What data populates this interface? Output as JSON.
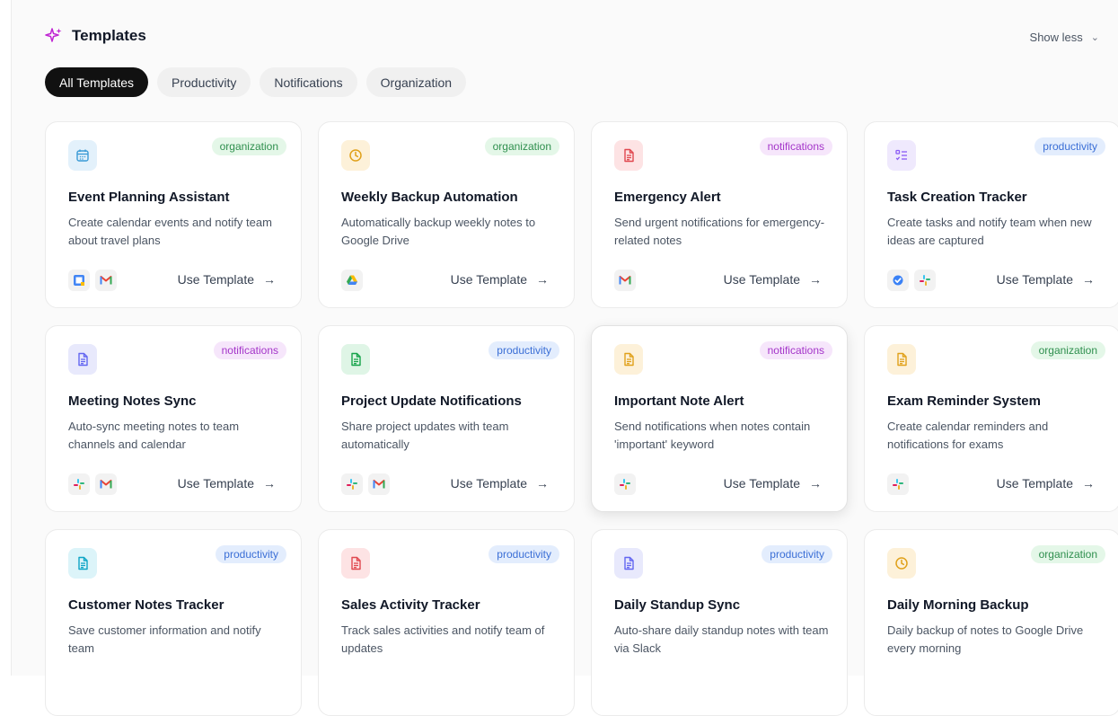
{
  "header": {
    "title": "Templates",
    "show_less": "Show less",
    "icon": "sparkle-icon"
  },
  "tabs": [
    {
      "label": "All Templates",
      "active": true
    },
    {
      "label": "Productivity",
      "active": false
    },
    {
      "label": "Notifications",
      "active": false
    },
    {
      "label": "Organization",
      "active": false
    }
  ],
  "use_template_label": "Use Template",
  "cards": [
    {
      "title": "Event Planning Assistant",
      "desc": "Create calendar events and notify team about travel plans",
      "badge": "organization",
      "icon": "calendar-icon",
      "icon_color": "#3b9bd6",
      "icon_bg": "#e3f1fb",
      "apps": [
        "google-calendar-icon",
        "gmail-icon"
      ]
    },
    {
      "title": "Weekly Backup Automation",
      "desc": "Automatically backup weekly notes to Google Drive",
      "badge": "organization",
      "icon": "clock-icon",
      "icon_color": "#e0a11b",
      "icon_bg": "#fdf1d9",
      "apps": [
        "google-drive-icon"
      ]
    },
    {
      "title": "Emergency Alert",
      "desc": "Send urgent notifications for emergency-related notes",
      "badge": "notifications",
      "icon": "document-icon",
      "icon_color": "#e0484f",
      "icon_bg": "#fde3e4",
      "apps": [
        "gmail-icon"
      ]
    },
    {
      "title": "Task Creation Tracker",
      "desc": "Create tasks and notify team when new ideas are captured",
      "badge": "productivity",
      "icon": "checklist-icon",
      "icon_color": "#8b5cf6",
      "icon_bg": "#efe9fd",
      "apps": [
        "task-check-icon",
        "slack-icon"
      ]
    },
    {
      "title": "Meeting Notes Sync",
      "desc": "Auto-sync meeting notes to team channels and calendar",
      "badge": "notifications",
      "icon": "document-icon",
      "icon_color": "#6366f1",
      "icon_bg": "#e8e9fc",
      "apps": [
        "slack-icon",
        "gmail-icon"
      ]
    },
    {
      "title": "Project Update Notifications",
      "desc": "Share project updates with team automatically",
      "badge": "productivity",
      "icon": "document-icon",
      "icon_color": "#16a34a",
      "icon_bg": "#dff5e6",
      "apps": [
        "slack-icon",
        "gmail-icon"
      ]
    },
    {
      "title": "Important Note Alert",
      "desc": "Send notifications when notes contain 'important' keyword",
      "badge": "notifications",
      "icon": "document-icon",
      "icon_color": "#e0a11b",
      "icon_bg": "#fdf1d9",
      "apps": [
        "slack-icon"
      ]
    },
    {
      "title": "Exam Reminder System",
      "desc": "Create calendar reminders and notifications for exams",
      "badge": "organization",
      "icon": "document-icon",
      "icon_color": "#e0a11b",
      "icon_bg": "#fdf1d9",
      "apps": [
        "slack-icon"
      ]
    },
    {
      "title": "Customer Notes Tracker",
      "desc": "Save customer information and notify team",
      "badge": "productivity",
      "icon": "document-icon",
      "icon_color": "#0ea5c6",
      "icon_bg": "#dcf4f9",
      "apps": []
    },
    {
      "title": "Sales Activity Tracker",
      "desc": "Track sales activities and notify team of updates",
      "badge": "productivity",
      "icon": "document-icon",
      "icon_color": "#e0484f",
      "icon_bg": "#fde3e4",
      "apps": []
    },
    {
      "title": "Daily Standup Sync",
      "desc": "Auto-share daily standup notes with team via Slack",
      "badge": "productivity",
      "icon": "document-icon",
      "icon_color": "#6366f1",
      "icon_bg": "#e8e9fc",
      "apps": []
    },
    {
      "title": "Daily Morning Backup",
      "desc": "Daily backup of notes to Google Drive every morning",
      "badge": "organization",
      "icon": "clock-icon",
      "icon_color": "#e0a11b",
      "icon_bg": "#fdf1d9",
      "apps": []
    }
  ]
}
